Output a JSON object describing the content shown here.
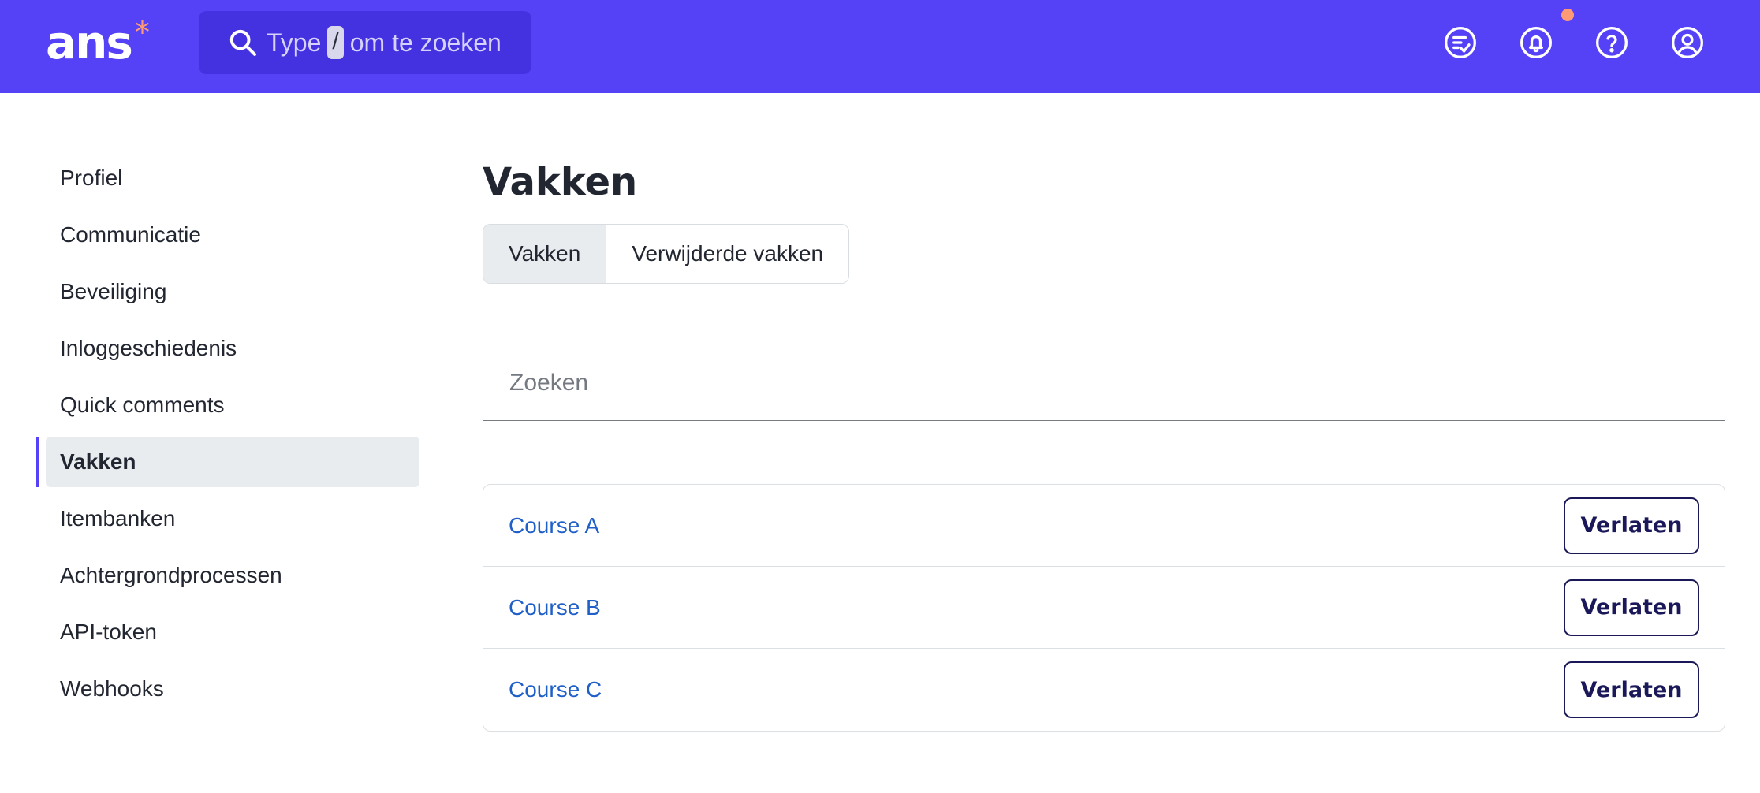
{
  "header": {
    "logo_text": "ans",
    "logo_mark": "*",
    "search": {
      "prefix": "Type",
      "shortcut_key": "/",
      "suffix": "om te zoeken"
    },
    "icons": [
      "tasks-icon",
      "bell-icon",
      "help-icon",
      "user-icon"
    ],
    "notification_dot_color": "#ff9b74"
  },
  "sidebar": {
    "items": [
      {
        "label": "Profiel",
        "active": false
      },
      {
        "label": "Communicatie",
        "active": false
      },
      {
        "label": "Beveiliging",
        "active": false
      },
      {
        "label": "Inloggeschiedenis",
        "active": false
      },
      {
        "label": "Quick comments",
        "active": false
      },
      {
        "label": "Vakken",
        "active": true
      },
      {
        "label": "Itembanken",
        "active": false
      },
      {
        "label": "Achtergrondprocessen",
        "active": false
      },
      {
        "label": "API-token",
        "active": false
      },
      {
        "label": "Webhooks",
        "active": false
      }
    ]
  },
  "main": {
    "title": "Vakken",
    "tabs": [
      {
        "label": "Vakken",
        "active": true
      },
      {
        "label": "Verwijderde vakken",
        "active": false
      }
    ],
    "search_placeholder": "Zoeken",
    "courses": [
      {
        "name": "Course A",
        "action": "Verlaten"
      },
      {
        "name": "Course B",
        "action": "Verlaten"
      },
      {
        "name": "Course C",
        "action": "Verlaten"
      }
    ]
  },
  "colors": {
    "brand": "#5542f6",
    "link": "#1f5fc8",
    "button_border": "#1b1859",
    "active_bg": "#e9ecef"
  }
}
